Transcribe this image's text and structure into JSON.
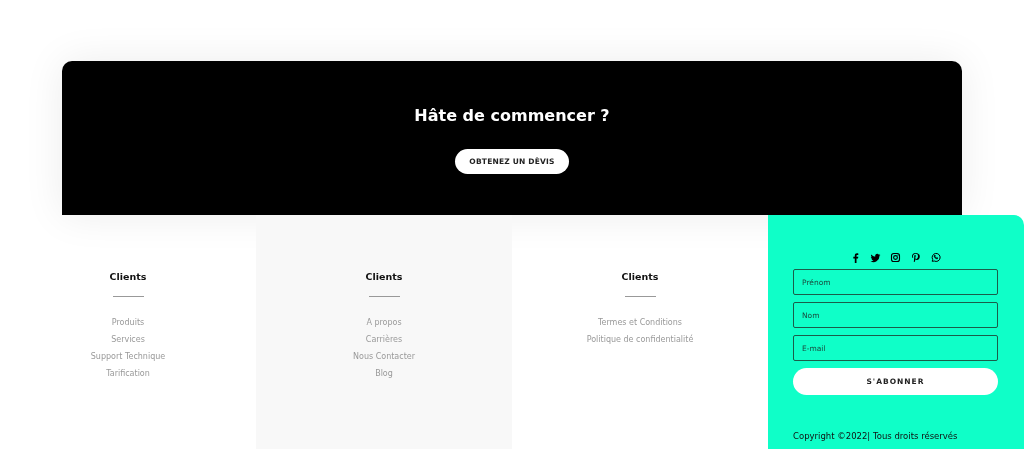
{
  "banner": {
    "title": "Hâte de commencer ?",
    "button": "OBTENEZ UN DÈVIS"
  },
  "columns": [
    {
      "heading": "Clients",
      "links": [
        "Produits",
        "Services",
        "Support Technique",
        "Tarification"
      ]
    },
    {
      "heading": "Clients",
      "links": [
        "A propos",
        "Carrières",
        "Nous Contacter",
        "Blog"
      ]
    },
    {
      "heading": "Clients",
      "links": [
        "Termes et Conditions",
        "Politique de confidentialité"
      ]
    }
  ],
  "newsletter": {
    "fields": [
      {
        "placeholder": "Prénom"
      },
      {
        "placeholder": "Nom"
      },
      {
        "placeholder": "E-mail"
      }
    ],
    "button": "S'ABONNER",
    "copyright": "Copyright ©2022| Tous droits réservés"
  }
}
